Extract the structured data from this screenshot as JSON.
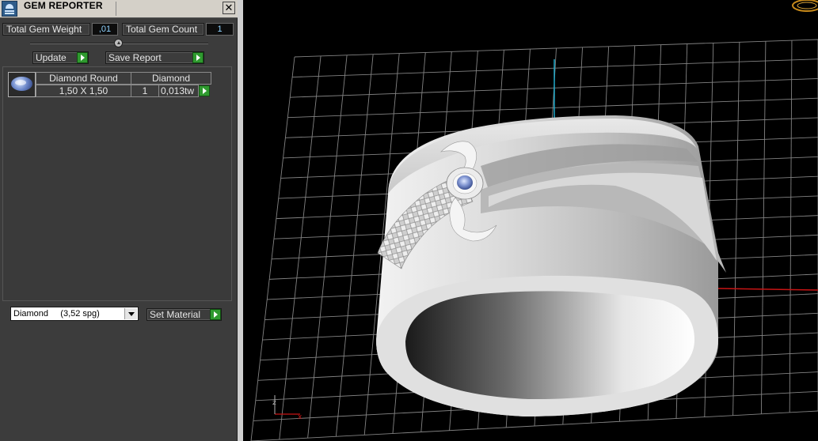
{
  "window": {
    "title": "GEM REPORTER",
    "close_glyph": "✕"
  },
  "totals": {
    "weight_label": "Total Gem Weight",
    "weight_value": ",01",
    "count_label": "Total Gem Count",
    "count_value": "1"
  },
  "actions": {
    "update_label": "Update",
    "save_report_label": "Save Report"
  },
  "gem_table": {
    "headers": [
      "Diamond Round",
      "Diamond"
    ],
    "rows": [
      {
        "size": "1,50 X 1,50",
        "count": "1",
        "weight": "0,013tw"
      }
    ]
  },
  "material": {
    "selected": "Diamond     (3,52 spg)",
    "set_label": "Set Material"
  },
  "viewport": {
    "axis_labels": {
      "x": "x",
      "z": "z"
    }
  },
  "colors": {
    "accent_green": "#2f9a2f",
    "value_blue": "#8fd3ff",
    "axis_red": "#c81414",
    "axis_cyan": "#1fa8c8"
  }
}
